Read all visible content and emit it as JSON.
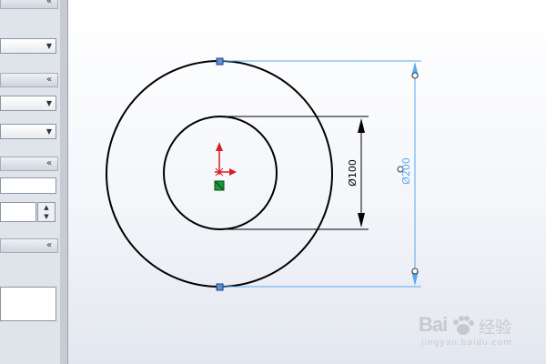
{
  "panel": {
    "collapse_glyph": "«",
    "dropdown_arrow": "▼",
    "spinner_up": "▲",
    "spinner_down": "▼"
  },
  "sketch": {
    "outer_dimension_label": "Ø200",
    "inner_dimension_label": "Ø100",
    "dimension_color": "#5aa9f0",
    "sketch_color": "#000000",
    "origin_color": "#d81e1e",
    "origin_point_color": "#1a9a3a"
  },
  "watermark": {
    "logo": "Bai",
    "name": "经验",
    "url": "jingyan.baidu.com"
  },
  "icons": [
    "collapse-icon",
    "dropdown-arrow-icon",
    "spinner-icon",
    "origin-icon",
    "paw-icon"
  ]
}
